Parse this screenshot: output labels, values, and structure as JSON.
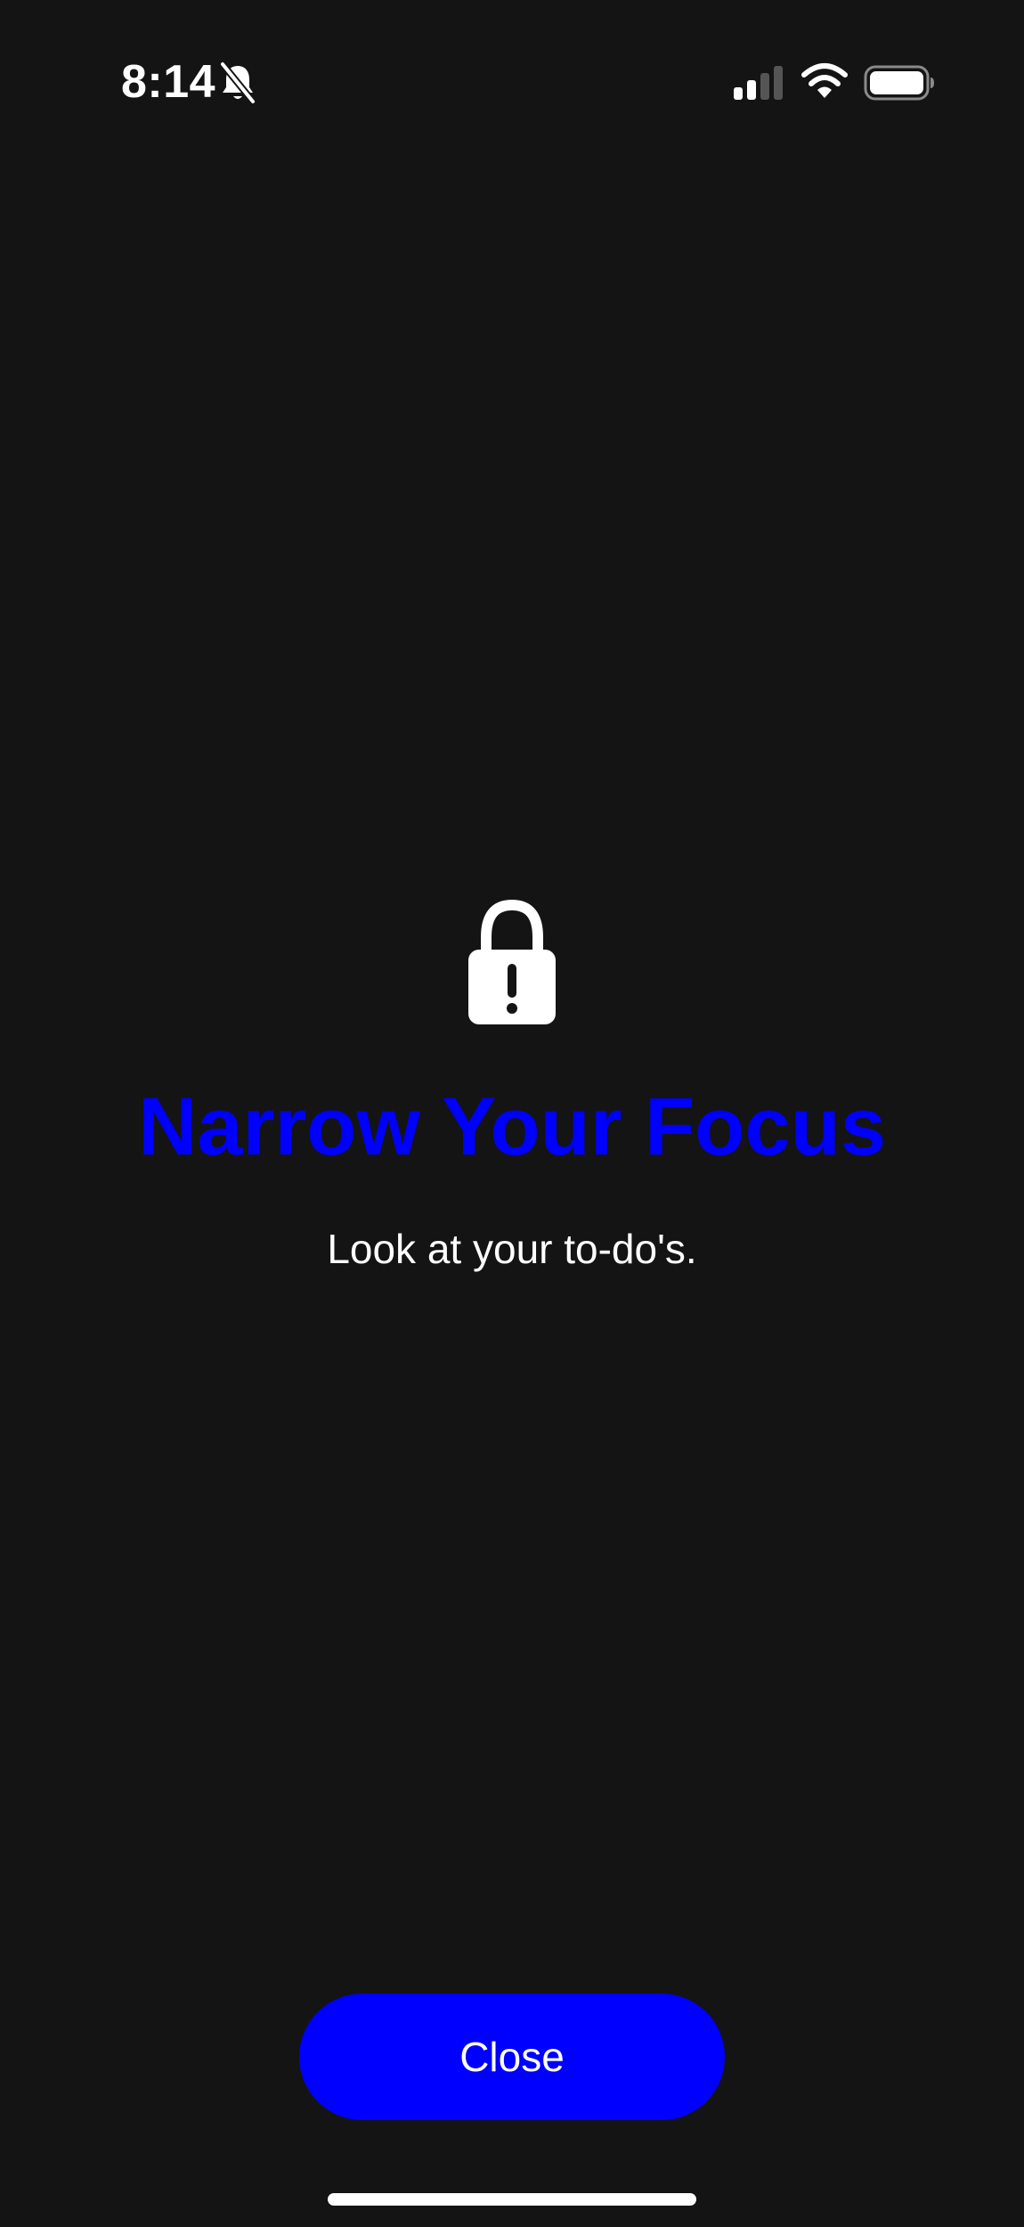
{
  "status_bar": {
    "time": "8:14",
    "icons": [
      "bell-slash-icon",
      "cellular-signal-icon",
      "wifi-icon",
      "battery-icon"
    ]
  },
  "main": {
    "icon": "lock-exclamation-icon",
    "title": "Narrow Your Focus",
    "subtitle": "Look at your to-do's."
  },
  "actions": {
    "close_label": "Close"
  },
  "colors": {
    "background": "#141414",
    "accent": "#0000ff",
    "text": "#ffffff"
  }
}
